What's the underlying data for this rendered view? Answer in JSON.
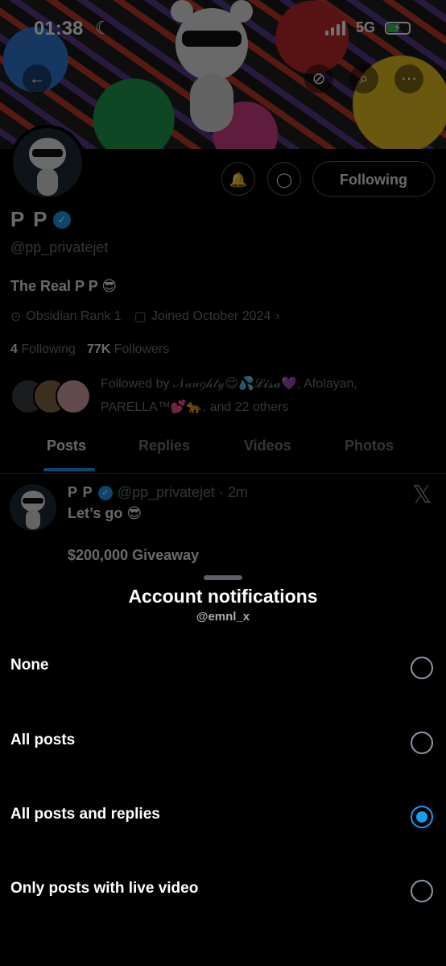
{
  "status_bar": {
    "time": "01:38",
    "network": "5G"
  },
  "banner": {
    "icons": [
      "back-arrow-icon",
      "no-notifications-icon",
      "search-icon",
      "more-icon"
    ]
  },
  "profile": {
    "following_button": "Following",
    "name": "P P",
    "handle": "@pp_privatejet",
    "bio": "The Real P P 😎",
    "location": "Obsidian Rank 1",
    "joined": "Joined October 2024",
    "following_count": "4",
    "following_label": "Following",
    "followers_count": "77K",
    "followers_label": "Followers",
    "followed_by": "Followed by 𝒩𝒶𝓊𝑔𝒽𝓉𝓎😌💦𝓛𝓲𝓼𝓪💜, Afolayan, PARELLA™💕🐆, and 22 others"
  },
  "tabs": [
    {
      "label": "Posts",
      "active": true
    },
    {
      "label": "Replies",
      "active": false
    },
    {
      "label": "Videos",
      "active": false
    },
    {
      "label": "Photos",
      "active": false
    }
  ],
  "post": {
    "name": "P P",
    "handle_time": "@pp_privatejet · 2m",
    "line1": "Let’s go 😎",
    "line2": "$200,000 Giveaway"
  },
  "sheet": {
    "title": "Account notifications",
    "subtitle": "@emnl_x",
    "options": [
      {
        "label": "None",
        "selected": false
      },
      {
        "label": "All posts",
        "selected": false
      },
      {
        "label": "All posts and replies",
        "selected": true
      },
      {
        "label": "Only posts with live video",
        "selected": false
      }
    ]
  },
  "colors": {
    "accent": "#1d9bf0",
    "background": "#000000"
  }
}
